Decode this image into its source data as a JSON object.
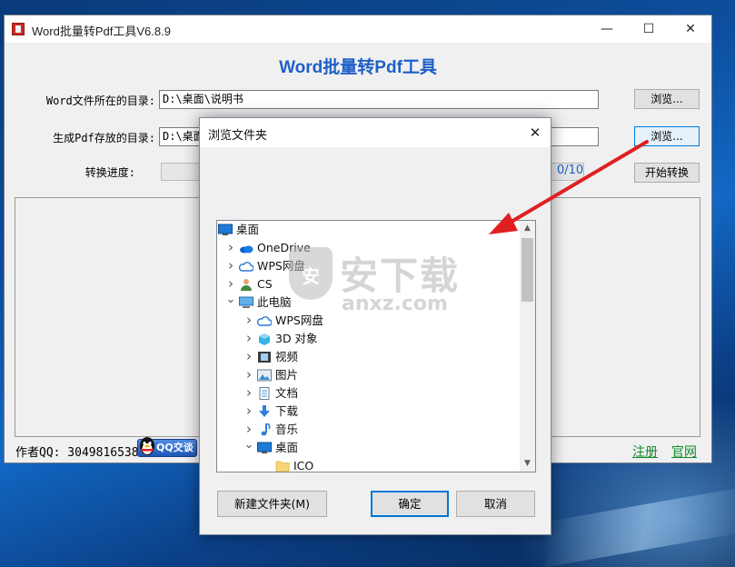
{
  "app": {
    "window_title": "Word批量转Pdf工具V6.8.9",
    "heading": "Word批量转Pdf工具",
    "source_dir_label": "Word文件所在的目录:",
    "source_dir_value": "D:\\桌面\\说明书",
    "output_dir_label": "生成Pdf存放的目录:",
    "output_dir_value": "D:\\桌面",
    "browse_label": "浏览...",
    "progress_label": "转换进度:",
    "progress_count": "0/10",
    "progress_fraction": 0,
    "start_label": "开始转换",
    "author_label": "作者QQ: 3049816538",
    "qq_button_label": "QQ交谈",
    "register_link": "注册",
    "website_link": "官网"
  },
  "dialog": {
    "title": "浏览文件夹",
    "tree": [
      {
        "label": "桌面",
        "icon": "desktop-icon",
        "level": 0,
        "chevron": ""
      },
      {
        "label": "OneDrive",
        "icon": "onedrive-cloud-icon",
        "level": 1,
        "chevron": "right"
      },
      {
        "label": "WPS网盘",
        "icon": "wps-cloud-icon",
        "level": 1,
        "chevron": "right"
      },
      {
        "label": "CS",
        "icon": "user-icon",
        "level": 1,
        "chevron": "right"
      },
      {
        "label": "此电脑",
        "icon": "computer-icon",
        "level": 1,
        "chevron": "down"
      },
      {
        "label": "WPS网盘",
        "icon": "wps-cloud-icon",
        "level": 2,
        "chevron": "right"
      },
      {
        "label": "3D 对象",
        "icon": "3d-objects-icon",
        "level": 2,
        "chevron": "right"
      },
      {
        "label": "视频",
        "icon": "video-icon",
        "level": 2,
        "chevron": "right"
      },
      {
        "label": "图片",
        "icon": "pictures-icon",
        "level": 2,
        "chevron": "right"
      },
      {
        "label": "文档",
        "icon": "documents-icon",
        "level": 2,
        "chevron": "right"
      },
      {
        "label": "下载",
        "icon": "download-icon",
        "level": 2,
        "chevron": "right"
      },
      {
        "label": "音乐",
        "icon": "music-icon",
        "level": 2,
        "chevron": "right"
      },
      {
        "label": "桌面",
        "icon": "desktop-icon",
        "level": 2,
        "chevron": "down"
      },
      {
        "label": "ICO",
        "icon": "folder-icon",
        "level": 3,
        "chevron": ""
      }
    ],
    "new_folder_label": "新建文件夹(M)",
    "ok_label": "确定",
    "cancel_label": "取消"
  },
  "watermark": {
    "text": "安下载",
    "sub": "anxz.com",
    "shield": "安"
  },
  "colors": {
    "heading_blue": "#1e5fc7",
    "link_green": "#118a2a",
    "arrow_red": "#e02020",
    "focus_blue": "#0078d7"
  }
}
